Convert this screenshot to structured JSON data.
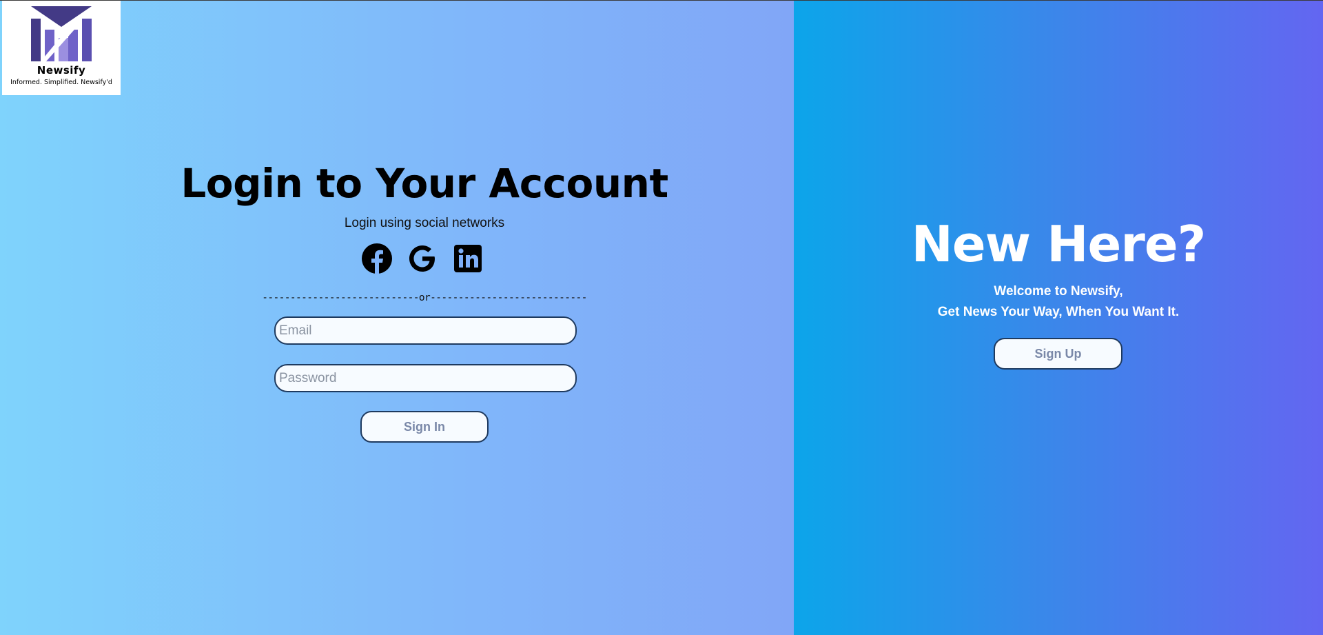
{
  "brand": {
    "name": "Newsify",
    "tagline": "Informed. Simplified. Newsify'd",
    "logo_icon": "newsify-m-logo"
  },
  "login": {
    "title": "Login to Your Account",
    "social_text": "Login using social networks",
    "social_icons": [
      "facebook-icon",
      "google-icon",
      "linkedin-icon"
    ],
    "divider": "----------------------------or----------------------------",
    "email_placeholder": "Email",
    "password_placeholder": "Password",
    "signin_label": "Sign In"
  },
  "register": {
    "title": "New Here?",
    "welcome_line1": "Welcome to Newsify,",
    "welcome_line2": "Get News Your Way, When You Want It.",
    "signup_label": "Sign Up"
  },
  "colors": {
    "left_gradient": [
      "#7fd3fc",
      "#81a6f7"
    ],
    "right_gradient": [
      "#0ca5ea",
      "#6366f1"
    ],
    "button_text": "#7a88a8",
    "border": "#1e3a5f"
  }
}
